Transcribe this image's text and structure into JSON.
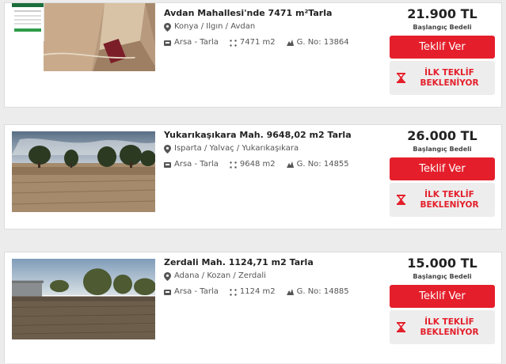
{
  "listings": [
    {
      "title": "Avdan Mahallesi'nde 7471 m²Tarla",
      "location": "Konya / Ilgın / Avdan",
      "category": "Arsa - Tarla",
      "area": "7471 m2",
      "parcel": "G. No: 13864",
      "price": "21.900 TL",
      "price_label": "Başlangıç Bedeli",
      "offer_button": "Teklif Ver",
      "status_line1": "İLK TEKLİF",
      "status_line2": "BEKLENİYOR"
    },
    {
      "title": "Yukarıkaşıkara Mah. 9648,02 m2 Tarla",
      "location": "Isparta / Yalvaç / Yukarıkaşıkara",
      "category": "Arsa - Tarla",
      "area": "9648 m2",
      "parcel": "G. No: 14855",
      "price": "26.000 TL",
      "price_label": "Başlangıç Bedeli",
      "offer_button": "Teklif Ver",
      "status_line1": "İLK TEKLİF",
      "status_line2": "BEKLENİYOR"
    },
    {
      "title": "Zerdali Mah. 1124,71 m2 Tarla",
      "location": "Adana / Kozan / Zerdali",
      "category": "Arsa - Tarla",
      "area": "1124 m2",
      "parcel": "G. No: 14885",
      "price": "15.000 TL",
      "price_label": "Başlangıç Bedeli",
      "offer_button": "Teklif Ver",
      "status_line1": "İLK TEKLİF",
      "status_line2": "BEKLENİYOR"
    }
  ],
  "colors": {
    "accent": "#e41f2b",
    "status_bg": "#ededed"
  },
  "icons": [
    "map-pin-icon",
    "building-icon",
    "area-dots-icon",
    "parcel-icon",
    "hourglass-icon"
  ]
}
